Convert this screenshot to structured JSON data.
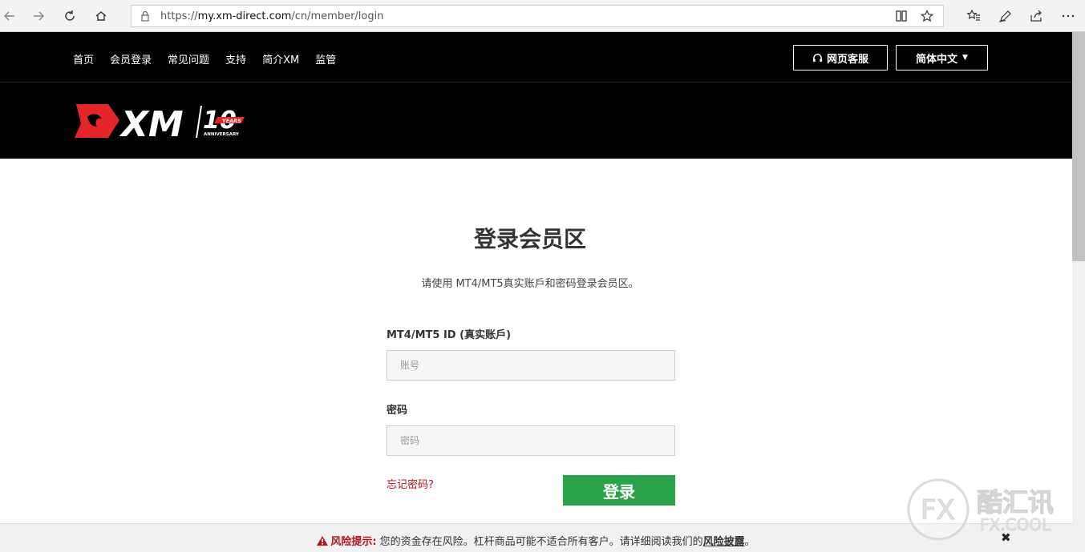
{
  "browser": {
    "url_prefix": "https://",
    "url_domain": "my.xm-direct.com",
    "url_path": "/cn/member/login"
  },
  "nav": {
    "links": [
      "首页",
      "会员登录",
      "常见问题",
      "支持",
      "简介XM",
      "监管"
    ],
    "service_label": "网页客服",
    "language_label": "简体中文"
  },
  "logo": {
    "brand": "XM",
    "anniversary_text": "10",
    "years_text": "YEARS",
    "anniversary_word": "ANNIVERSARY"
  },
  "login": {
    "title": "登录会员区",
    "subtitle": "请使用 MT4/MT5真实账戶和密码登录会员区。",
    "account_label": "MT4/MT5 ID (真实账戶)",
    "account_placeholder": "账号",
    "password_label": "密码",
    "password_placeholder": "密码",
    "forgot_label": "忘记密码?",
    "submit_label": "登录"
  },
  "risk": {
    "prefix": "风险提示:",
    "text": " 您的资金存在风险。杠杆商品可能不适合所有客户。请详细阅读我们的",
    "link": "风险披露",
    "suffix": "。",
    "close": "✖"
  },
  "watermark": {
    "fx": "FX",
    "chinese": "酷汇讯",
    "site": "FX.COOL"
  },
  "colors": {
    "brand_red": "#e4262b",
    "login_green": "#2aa34a",
    "link_red": "#b5121b",
    "header_black": "#000000"
  }
}
